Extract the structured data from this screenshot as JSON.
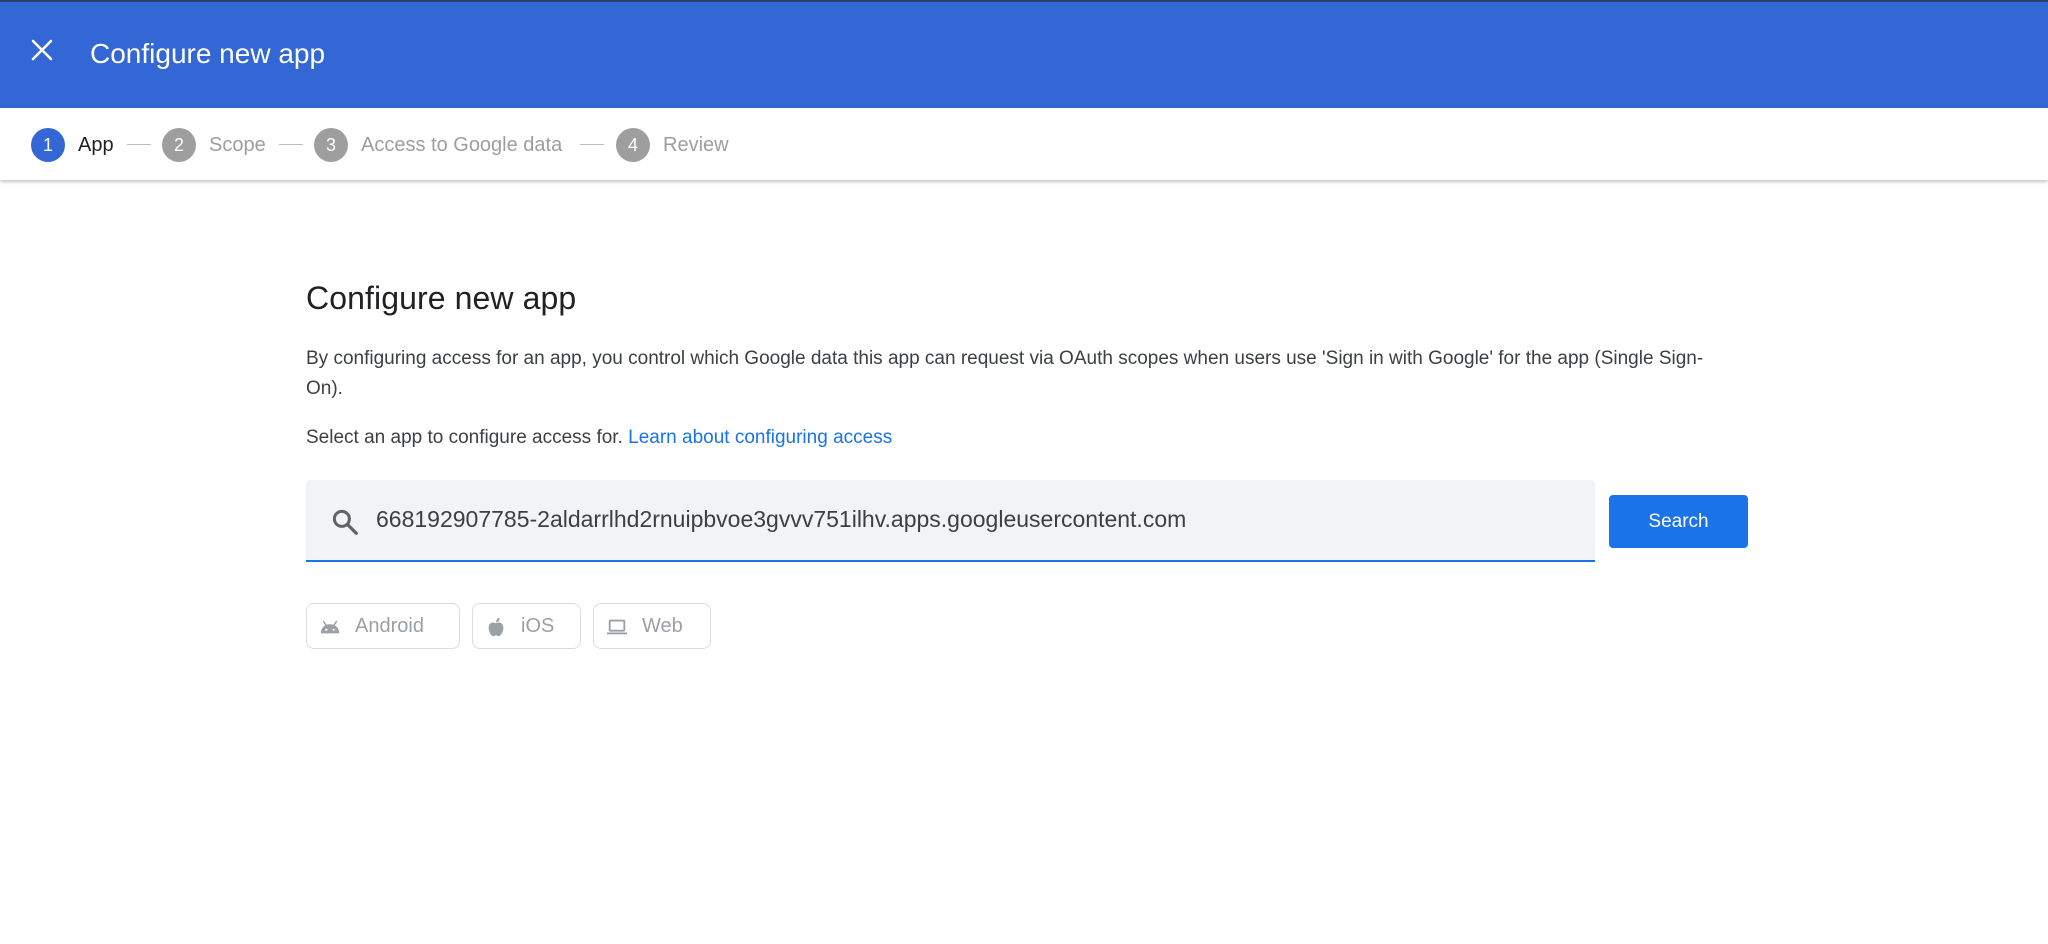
{
  "header": {
    "title": "Configure new app",
    "close_icon": "close-icon"
  },
  "stepper": {
    "steps": [
      {
        "number": "1",
        "label": "App",
        "active": true
      },
      {
        "number": "2",
        "label": "Scope",
        "active": false
      },
      {
        "number": "3",
        "label": "Access to Google data",
        "active": false
      },
      {
        "number": "4",
        "label": "Review",
        "active": false
      }
    ]
  },
  "main": {
    "heading": "Configure new app",
    "description": "By configuring access for an app, you control which Google data this app can request via OAuth scopes when users use 'Sign in with Google' for the app (Single Sign-On).",
    "select_text": "Select an app to configure access for.",
    "learn_link": "Learn about configuring access",
    "search": {
      "value": "668192907785-2aldarrlhd2rnuipbvoe3gvvv751ilhv.apps.googleusercontent.com",
      "icon": "search-icon",
      "button_label": "Search"
    },
    "platform_chips": [
      {
        "label": "Android",
        "icon": "android-icon"
      },
      {
        "label": "iOS",
        "icon": "apple-icon"
      },
      {
        "label": "Web",
        "icon": "laptop-icon"
      }
    ]
  },
  "colors": {
    "header_bg": "#3367d6",
    "primary": "#1a73e8",
    "inactive": "#9e9e9e"
  }
}
